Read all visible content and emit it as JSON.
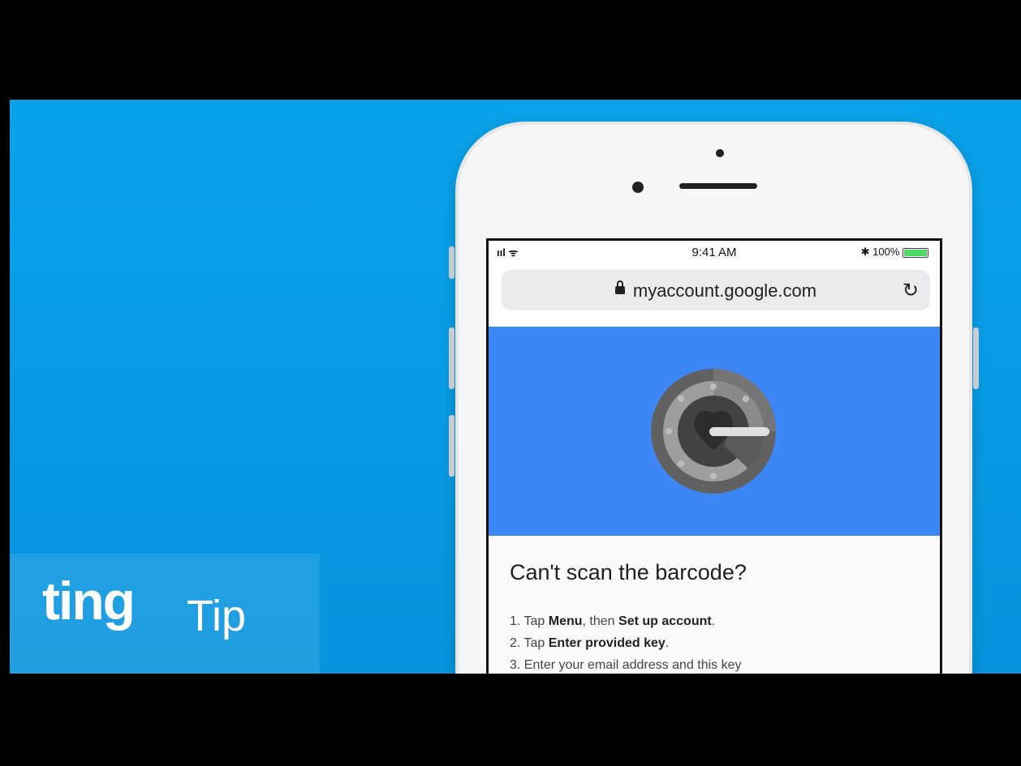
{
  "brand": {
    "name": "ting",
    "tag": "Tip"
  },
  "phone": {
    "status": {
      "time": "9:41 AM",
      "signal": "ııl ᯤ",
      "battery": "✱ 100%"
    },
    "url": "myaccount.google.com",
    "icons": [
      "lock-icon",
      "reload-icon",
      "authenticator-icon"
    ],
    "content": {
      "heading": "Can't scan the barcode?",
      "steps": [
        {
          "num": "1.",
          "pre": "Tap ",
          "b1": "Menu",
          "mid": ", then ",
          "b2": "Set up account",
          "post": "."
        },
        {
          "num": "2.",
          "pre": "Tap ",
          "b1": "Enter provided key",
          "post": "."
        },
        {
          "num": "3.",
          "text": "Enter your email address and this key"
        }
      ]
    }
  },
  "colors": {
    "stage": "#0aa2ea",
    "hero": "#3d86f5",
    "frame": "#000000"
  }
}
